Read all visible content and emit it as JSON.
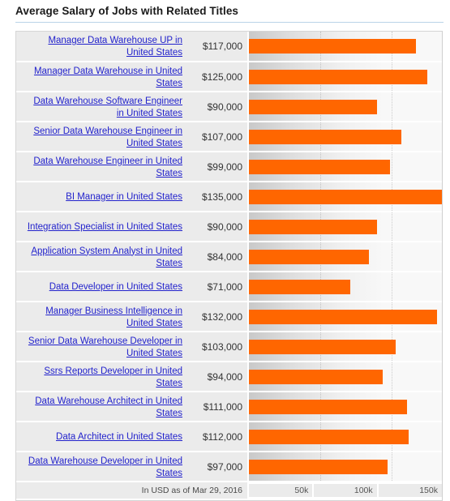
{
  "header": {
    "title": "Average Salary of Jobs with Related Titles"
  },
  "chart_data": {
    "type": "bar",
    "title": "Average Salary of Jobs with Related Titles",
    "orientation": "horizontal",
    "xlabel": "",
    "ylabel": "",
    "xlim": [
      0,
      155000
    ],
    "ticks": [
      "50k",
      "100k",
      "150k"
    ],
    "tick_values": [
      50000,
      100000,
      150000
    ],
    "grid": true,
    "legend": "none",
    "bar_color": "#ff6600",
    "currency_note": "In USD as of Mar 29, 2016",
    "categories": [
      "Manager Data Warehouse UP in United States",
      "Manager Data Warehouse in United States",
      "Data Warehouse Software Engineer in United States",
      "Senior Data Warehouse Engineer in United States",
      "Data Warehouse Engineer in United States",
      "BI Manager in United States",
      "Integration Specialist in United States",
      "Application System Analyst in United States",
      "Data Developer in United States",
      "Manager Business Intelligence in United States",
      "Senior Data Warehouse Developer in United States",
      "Ssrs Reports Developer in United States",
      "Data Warehouse Architect in United States",
      "Data Architect in United States",
      "Data Warehouse Developer in United States"
    ],
    "values": [
      117000,
      125000,
      90000,
      107000,
      99000,
      135000,
      90000,
      84000,
      71000,
      132000,
      103000,
      94000,
      111000,
      112000,
      97000
    ],
    "value_labels": [
      "$117,000",
      "$125,000",
      "$90,000",
      "$107,000",
      "$99,000",
      "$135,000",
      "$90,000",
      "$84,000",
      "$71,000",
      "$132,000",
      "$103,000",
      "$94,000",
      "$111,000",
      "$112,000",
      "$97,000"
    ]
  },
  "rows": [
    {
      "title": "Manager Data Warehouse UP in United States",
      "salary": "$117,000",
      "value": 117000
    },
    {
      "title": "Manager Data Warehouse in United States",
      "salary": "$125,000",
      "value": 125000
    },
    {
      "title": "Data Warehouse Software Engineer in United States",
      "salary": "$90,000",
      "value": 90000
    },
    {
      "title": "Senior Data Warehouse Engineer in United States",
      "salary": "$107,000",
      "value": 107000
    },
    {
      "title": "Data Warehouse Engineer in United States",
      "salary": "$99,000",
      "value": 99000
    },
    {
      "title": "BI Manager in United States",
      "salary": "$135,000",
      "value": 135000
    },
    {
      "title": "Integration Specialist in United States",
      "salary": "$90,000",
      "value": 90000
    },
    {
      "title": "Application System Analyst in United States",
      "salary": "$84,000",
      "value": 84000
    },
    {
      "title": "Data Developer in United States",
      "salary": "$71,000",
      "value": 71000
    },
    {
      "title": "Manager Business Intelligence in United States",
      "salary": "$132,000",
      "value": 132000
    },
    {
      "title": "Senior Data Warehouse Developer in United States",
      "salary": "$103,000",
      "value": 103000
    },
    {
      "title": "Ssrs Reports Developer in United States",
      "salary": "$94,000",
      "value": 94000
    },
    {
      "title": "Data Warehouse Architect in United States",
      "salary": "$111,000",
      "value": 111000
    },
    {
      "title": "Data Architect in United States",
      "salary": "$112,000",
      "value": 112000
    },
    {
      "title": "Data Warehouse Developer in United States",
      "salary": "$97,000",
      "value": 97000
    }
  ],
  "footer": {
    "note": "In USD as of Mar 29, 2016",
    "axis_ticks": [
      "50k",
      "100k",
      "150k"
    ]
  }
}
